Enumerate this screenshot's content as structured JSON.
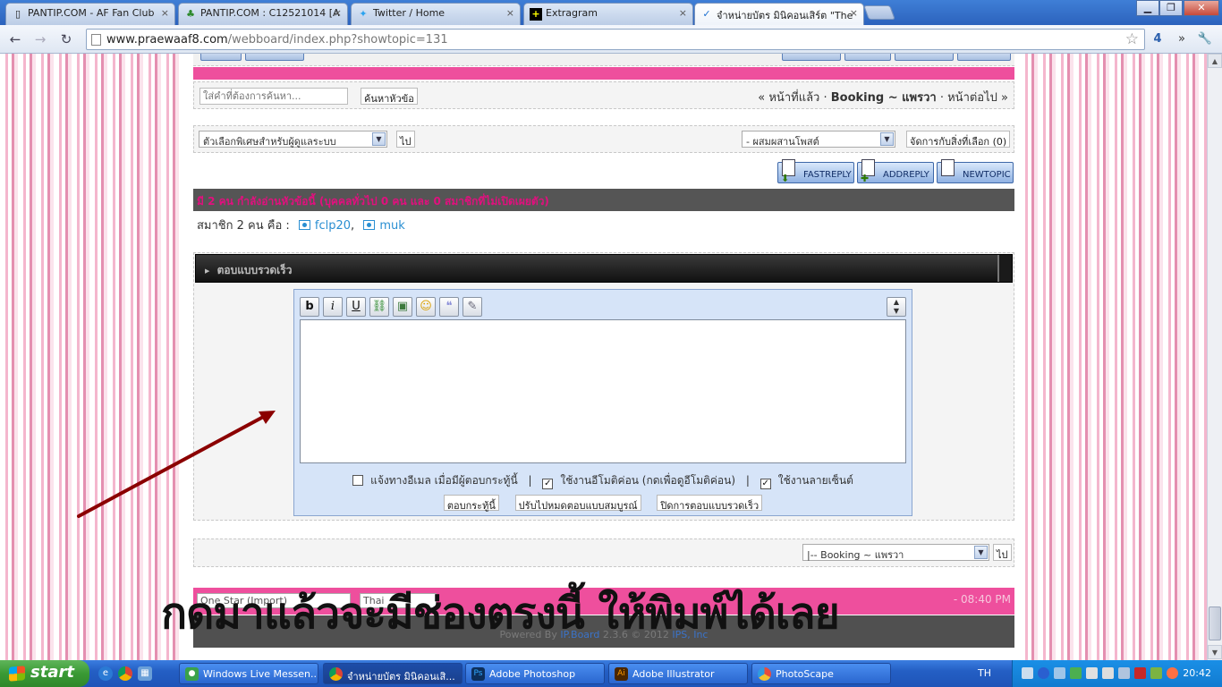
{
  "browser": {
    "tabs": [
      {
        "title": "PANTIP.COM - AF Fan Club",
        "favicon": "page-icon"
      },
      {
        "title": "PANTIP.COM : C12521014 [A",
        "favicon": "cactus-icon"
      },
      {
        "title": "Twitter / Home",
        "favicon": "twitter-bird-icon"
      },
      {
        "title": "Extragram",
        "favicon": "plus-icon"
      },
      {
        "title": "จำหน่ายบัตร มินิคอนเสิร์ต \"The",
        "favicon": "checkmark-icon"
      }
    ],
    "active_tab": 4,
    "close_glyph": "×",
    "url_host": "www.praewaaf8.com",
    "url_path": "/webboard/index.php?showtopic=131",
    "ext_badge": "4",
    "menu_chevron": "»",
    "wrench_glyph": "🔧"
  },
  "forum": {
    "search_placeholder": "ใส่คำที่ต้องการค้นหา...",
    "search_button": "ค้นหาหัวข้อ",
    "nav_prev": "« หน้าที่แล้ว",
    "nav_sep": "·",
    "forum_name": "Booking ~ แพรวา",
    "nav_next": "หน้าต่อไป »",
    "mod_options": "ตัวเลือกพิเศษสำหรับผู้ดูแลระบบ",
    "go": "ไป",
    "mode_select": "- ผสมผสานโพสต์",
    "manage_selected": "จัดการกับสิ่งที่เลือก (0)",
    "fastreply": "FASTREPLY",
    "addreply": "ADDREPLY",
    "newtopic": "NEWTOPIC",
    "viewers": "มี 2 คน กำลังอ่านหัวข้อนี้ (บุคคลทั่วไป 0 คน และ 0 สมาชิกที่ไม่เปิดเผยตัว)",
    "members_label": "สมาชิก 2 คน คือ :",
    "members": [
      "fclp20",
      "muk"
    ],
    "member_sep": ",",
    "quick_reply_title": "ตอบแบบรวดเร็ว",
    "editor_buttons": [
      "b",
      "i",
      "U",
      "",
      "",
      "",
      "",
      ""
    ],
    "opt_email": "แจ้งทางอีเมล เมื่อมีผู้ตอบกระทู้นี้",
    "opt_emoticons": "ใช้งานอีโมติค่อน (กดเพื่อดูอีโมติค่อน)",
    "opt_signature": "ใช้งานลายเซ็นต์",
    "opt_sep": "|",
    "checked": "✓",
    "btn_post": "ตอบกระทู้นี้",
    "btn_full": "ปรับไปหมดตอบแบบสมบูรณ์",
    "btn_close": "ปิดการตอบแบบรวดเร็ว",
    "jump_select": "|-- Booking ~ แพรวา",
    "footer_skin": "One Star (Import)",
    "footer_lang": "Thai",
    "footer_time": "- 08:40 PM",
    "powered_by": "Powered By",
    "ipb": "IP.Board",
    "ipb_version": "2.3.6 © 2012",
    "ipb_company": "IPS, Inc"
  },
  "annotation": {
    "text": "กดมาแล้วจะมีช่องตรงนี้ ให้พิมพ์ได้เลย",
    "color": "#8b0000"
  },
  "taskbar": {
    "start": "start",
    "items": [
      {
        "label": "Windows Live Messen...",
        "icon": "messenger-icon"
      },
      {
        "label": "จำหน่ายบัตร มินิคอนเสิ...",
        "icon": "chrome-icon"
      },
      {
        "label": "Adobe Photoshop",
        "icon": "photoshop-icon"
      },
      {
        "label": "Adobe Illustrator",
        "icon": "illustrator-icon"
      },
      {
        "label": "PhotoScape",
        "icon": "photoscape-icon"
      }
    ],
    "active_item": 1,
    "lang": "TH",
    "clock": "20:42"
  }
}
